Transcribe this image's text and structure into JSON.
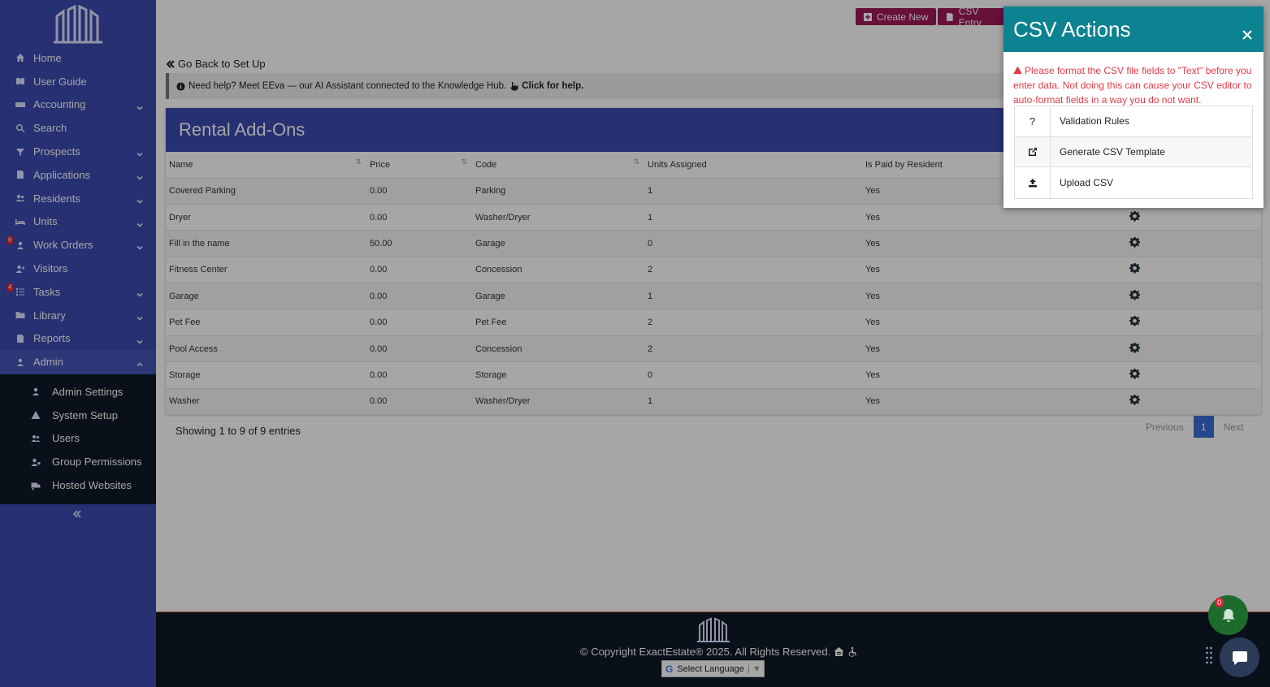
{
  "sidebar": {
    "items": [
      {
        "label": "Home",
        "icon": "home-icon",
        "chevron": false
      },
      {
        "label": "User Guide",
        "icon": "book-icon",
        "chevron": false
      },
      {
        "label": "Accounting",
        "icon": "money-icon",
        "chevron": true
      },
      {
        "label": "Search",
        "icon": "search-icon",
        "chevron": false
      },
      {
        "label": "Prospects",
        "icon": "funnel-icon",
        "chevron": true
      },
      {
        "label": "Applications",
        "icon": "file-icon",
        "chevron": true
      },
      {
        "label": "Residents",
        "icon": "users-icon",
        "chevron": true
      },
      {
        "label": "Units",
        "icon": "bed-icon",
        "chevron": true
      },
      {
        "label": "Work Orders",
        "icon": "worker-icon",
        "chevron": true,
        "badge": "6"
      },
      {
        "label": "Visitors",
        "icon": "user-plus-icon",
        "chevron": false
      },
      {
        "label": "Tasks",
        "icon": "list-icon",
        "chevron": true,
        "badge": "4"
      },
      {
        "label": "Library",
        "icon": "folder-icon",
        "chevron": true
      },
      {
        "label": "Reports",
        "icon": "report-icon",
        "chevron": true
      },
      {
        "label": "Admin",
        "icon": "admin-icon",
        "chevron": true,
        "active": true
      }
    ],
    "submenu": [
      {
        "label": "Admin Settings",
        "icon": "admin-user-icon"
      },
      {
        "label": "System Setup",
        "icon": "warning-icon"
      },
      {
        "label": "Users",
        "icon": "users-icon"
      },
      {
        "label": "Group Permissions",
        "icon": "user-group-icon"
      },
      {
        "label": "Hosted Websites",
        "icon": "truck-icon"
      }
    ]
  },
  "toolbar": {
    "create_new": "Create New",
    "csv_entry": "CSV Entry"
  },
  "back_link": "Go Back to Set Up",
  "help": {
    "text": "Need help? Meet EEva — our AI Assistant connected to the Knowledge Hub.",
    "link": "Click for help."
  },
  "card": {
    "title": "Rental Add-Ons",
    "columns": [
      "Name",
      "Price",
      "Code",
      "Units Assigned",
      "Is Paid by Resident"
    ],
    "rows": [
      [
        "Covered Parking",
        "0.00",
        "Parking",
        "1",
        "Yes"
      ],
      [
        "Dryer",
        "0.00",
        "Washer/Dryer",
        "1",
        "Yes"
      ],
      [
        "Fill in the name",
        "50.00",
        "Garage",
        "0",
        "Yes"
      ],
      [
        "Fitness Center",
        "0.00",
        "Concession",
        "2",
        "Yes"
      ],
      [
        "Garage",
        "0.00",
        "Garage",
        "1",
        "Yes"
      ],
      [
        "Pet Fee",
        "0.00",
        "Pet Fee",
        "2",
        "Yes"
      ],
      [
        "Pool Access",
        "0.00",
        "Concession",
        "2",
        "Yes"
      ],
      [
        "Storage",
        "0.00",
        "Storage",
        "0",
        "Yes"
      ],
      [
        "Washer",
        "0.00",
        "Washer/Dryer",
        "1",
        "Yes"
      ]
    ]
  },
  "pagination": {
    "showing": "Showing 1 to 9 of 9 entries",
    "previous": "Previous",
    "current": "1",
    "next": "Next"
  },
  "footer": {
    "copyright": "© Copyright ExactEstate® 2025. All Rights Reserved.",
    "language": "Select Language"
  },
  "csv_panel": {
    "title": "CSV Actions",
    "warning": "Please format the CSV file fields to \"Text\" before you enter data. Not doing this can cause your CSV editor to auto-format fields in a way you do not want.",
    "actions": [
      {
        "icon_text": "?",
        "label": "Validation Rules"
      },
      {
        "icon_text": "",
        "label": "Generate CSV Template"
      },
      {
        "icon_text": "",
        "label": "Upload CSV"
      }
    ]
  },
  "widgets": {
    "notification_count": "0"
  },
  "colors": {
    "sidebar": "#3b4bb0",
    "submenu": "#0f1a27",
    "panel_header": "#0d8290",
    "warning": "#e53946",
    "toolbar_button": "#9e1a5a"
  }
}
